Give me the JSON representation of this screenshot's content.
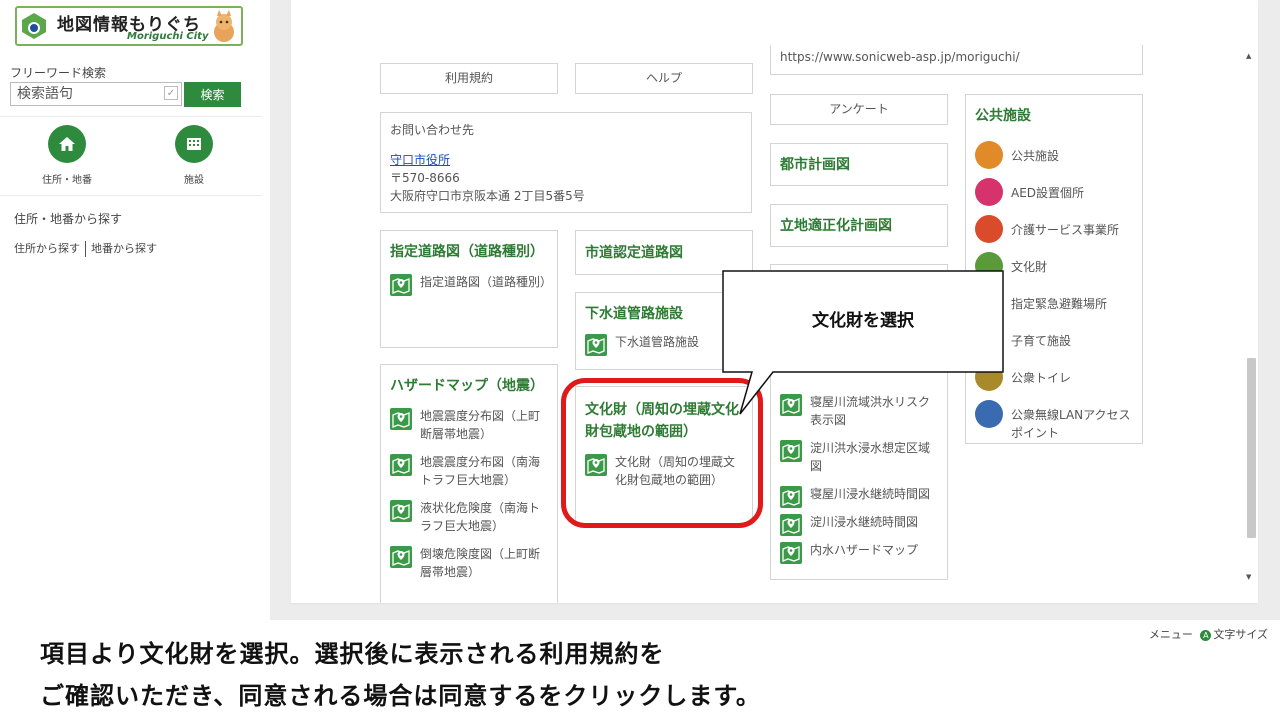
{
  "header": {
    "logo_title": "地図情報もりぐち",
    "logo_subtitle": "Moriguchi City"
  },
  "sidebar": {
    "free_word_label": "フリーワード検索",
    "search_placeholder": "検索語句",
    "search_button": "検索",
    "icon_buttons": [
      {
        "label": "住所・地番",
        "icon": "home-icon"
      },
      {
        "label": "施設",
        "icon": "building-icon"
      }
    ],
    "section_title": "住所・地番から探す",
    "links": [
      "住所から探す",
      "地番から探す"
    ]
  },
  "main": {
    "col1": {
      "terms_button": "利用規約",
      "contact": {
        "title": "お問い合わせ先",
        "link": "守口市役所",
        "postal": "〒570-8666",
        "address": "大阪府守口市京阪本通 2丁目5番5号"
      },
      "designated_road": {
        "heading": "指定道路図（道路種別）",
        "items": [
          "指定道路図（道路種別）"
        ]
      },
      "hazard": {
        "heading": "ハザードマップ（地震）",
        "items": [
          "地震震度分布図（上町断層帯地震）",
          "地震震度分布図（南海トラフ巨大地震）",
          "液状化危険度（南海トラフ巨大地震）",
          "倒壊危険度図（上町断層帯地震）"
        ]
      }
    },
    "col2": {
      "help_button": "ヘルプ",
      "city_road": {
        "heading": "市道認定道路図"
      },
      "sewer": {
        "heading": "下水道管路施設",
        "items": [
          "下水道管路施設"
        ]
      },
      "cultural": {
        "heading": "文化財（周知の埋蔵文化財包蔵地の範囲）",
        "items": [
          "文化財（周知の埋蔵文化財包蔵地の範囲）"
        ]
      }
    },
    "col3": {
      "url": "https://www.sonicweb-asp.jp/moriguchi/",
      "survey_button": "アンケート",
      "urban_plan": "都市計画図",
      "location_plan": "立地適正化計画図",
      "flood_items": [
        "寝屋川流域洪水リスク表示図",
        "淀川洪水浸水想定区域図",
        "寝屋川浸水継続時間図",
        "淀川浸水継続時間図",
        "内水ハザードマップ"
      ]
    },
    "col4": {
      "heading": "公共施設",
      "items": [
        {
          "label": "公共施設",
          "color": "#e08a2a"
        },
        {
          "label": "AED設置個所",
          "color": "#d6336c"
        },
        {
          "label": "介護サービス事業所",
          "color": "#d94b2b"
        },
        {
          "label": "文化財",
          "color": "#5a9a3a"
        },
        {
          "label": "指定緊急避難場所",
          "color": "#2f7bbf"
        },
        {
          "label": "子育て施設",
          "color": "#e06aa0"
        },
        {
          "label": "公衆トイレ",
          "color": "#a88a2a"
        },
        {
          "label": "公衆無線LANアクセスポイント",
          "color": "#3a6ab0"
        }
      ]
    }
  },
  "annotation": {
    "callout_text": "文化財を選択"
  },
  "footer": {
    "line1": "項目より文化財を選択。選択後に表示される利用規約を",
    "line2": "ご確認いただき、同意される場合は同意するをクリックします。",
    "menu": "メニュー",
    "font_size": "文字サイズ"
  }
}
